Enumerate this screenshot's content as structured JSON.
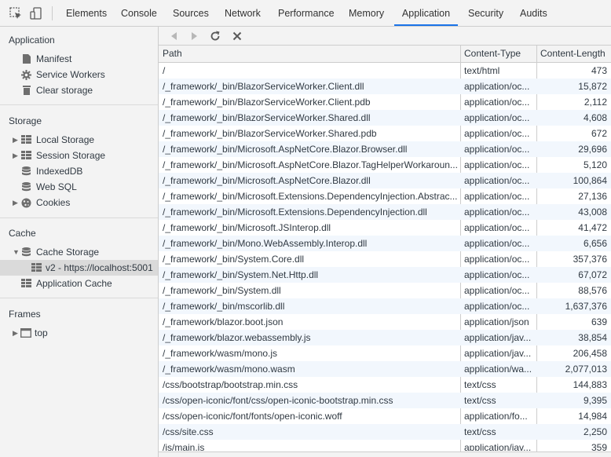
{
  "tabs": [
    {
      "label": "Elements",
      "active": false
    },
    {
      "label": "Console",
      "active": false
    },
    {
      "label": "Sources",
      "active": false
    },
    {
      "label": "Network",
      "active": false
    },
    {
      "label": "Performance",
      "active": false
    },
    {
      "label": "Memory",
      "active": false
    },
    {
      "label": "Application",
      "active": true
    },
    {
      "label": "Security",
      "active": false
    },
    {
      "label": "Audits",
      "active": false
    }
  ],
  "toolbar_icons": [
    "inspect-element-icon",
    "device-toolbar-icon"
  ],
  "sidebar": {
    "application": {
      "title": "Application",
      "items": [
        {
          "label": "Manifest",
          "icon": "document-icon"
        },
        {
          "label": "Service Workers",
          "icon": "gear-icon"
        },
        {
          "label": "Clear storage",
          "icon": "trash-icon"
        }
      ]
    },
    "storage": {
      "title": "Storage",
      "items": [
        {
          "label": "Local Storage",
          "icon": "grid-icon",
          "expandable": true
        },
        {
          "label": "Session Storage",
          "icon": "grid-icon",
          "expandable": true
        },
        {
          "label": "IndexedDB",
          "icon": "database-icon",
          "expandable": false
        },
        {
          "label": "Web SQL",
          "icon": "database-icon",
          "expandable": false
        },
        {
          "label": "Cookies",
          "icon": "cookie-icon",
          "expandable": true
        }
      ]
    },
    "cache": {
      "title": "Cache",
      "items": [
        {
          "label": "Cache Storage",
          "icon": "database-icon",
          "expanded": true
        },
        {
          "label": "v2 - https://localhost:5001",
          "icon": "grid-icon",
          "selected": true
        },
        {
          "label": "Application Cache",
          "icon": "grid-icon"
        }
      ]
    },
    "frames": {
      "title": "Frames",
      "items": [
        {
          "label": "top",
          "icon": "frame-icon",
          "expandable": true
        }
      ]
    }
  },
  "cache_toolbar": [
    "back-icon",
    "forward-icon",
    "refresh-icon",
    "delete-icon"
  ],
  "table": {
    "columns": [
      "Path",
      "Content-Type",
      "Content-Length"
    ],
    "rows": [
      [
        "/",
        "text/html",
        "473"
      ],
      [
        "/_framework/_bin/BlazorServiceWorker.Client.dll",
        "application/oc...",
        "15,872"
      ],
      [
        "/_framework/_bin/BlazorServiceWorker.Client.pdb",
        "application/oc...",
        "2,112"
      ],
      [
        "/_framework/_bin/BlazorServiceWorker.Shared.dll",
        "application/oc...",
        "4,608"
      ],
      [
        "/_framework/_bin/BlazorServiceWorker.Shared.pdb",
        "application/oc...",
        "672"
      ],
      [
        "/_framework/_bin/Microsoft.AspNetCore.Blazor.Browser.dll",
        "application/oc...",
        "29,696"
      ],
      [
        "/_framework/_bin/Microsoft.AspNetCore.Blazor.TagHelperWorkaroun...",
        "application/oc...",
        "5,120"
      ],
      [
        "/_framework/_bin/Microsoft.AspNetCore.Blazor.dll",
        "application/oc...",
        "100,864"
      ],
      [
        "/_framework/_bin/Microsoft.Extensions.DependencyInjection.Abstrac...",
        "application/oc...",
        "27,136"
      ],
      [
        "/_framework/_bin/Microsoft.Extensions.DependencyInjection.dll",
        "application/oc...",
        "43,008"
      ],
      [
        "/_framework/_bin/Microsoft.JSInterop.dll",
        "application/oc...",
        "41,472"
      ],
      [
        "/_framework/_bin/Mono.WebAssembly.Interop.dll",
        "application/oc...",
        "6,656"
      ],
      [
        "/_framework/_bin/System.Core.dll",
        "application/oc...",
        "357,376"
      ],
      [
        "/_framework/_bin/System.Net.Http.dll",
        "application/oc...",
        "67,072"
      ],
      [
        "/_framework/_bin/System.dll",
        "application/oc...",
        "88,576"
      ],
      [
        "/_framework/_bin/mscorlib.dll",
        "application/oc...",
        "1,637,376"
      ],
      [
        "/_framework/blazor.boot.json",
        "application/json",
        "639"
      ],
      [
        "/_framework/blazor.webassembly.js",
        "application/jav...",
        "38,854"
      ],
      [
        "/_framework/wasm/mono.js",
        "application/jav...",
        "206,458"
      ],
      [
        "/_framework/wasm/mono.wasm",
        "application/wa...",
        "2,077,013"
      ],
      [
        "/css/bootstrap/bootstrap.min.css",
        "text/css",
        "144,883"
      ],
      [
        "/css/open-iconic/font/css/open-iconic-bootstrap.min.css",
        "text/css",
        "9,395"
      ],
      [
        "/css/open-iconic/font/fonts/open-iconic.woff",
        "application/fo...",
        "14,984"
      ],
      [
        "/css/site.css",
        "text/css",
        "2,250"
      ],
      [
        "/js/main.js",
        "application/jav...",
        "359"
      ]
    ]
  }
}
